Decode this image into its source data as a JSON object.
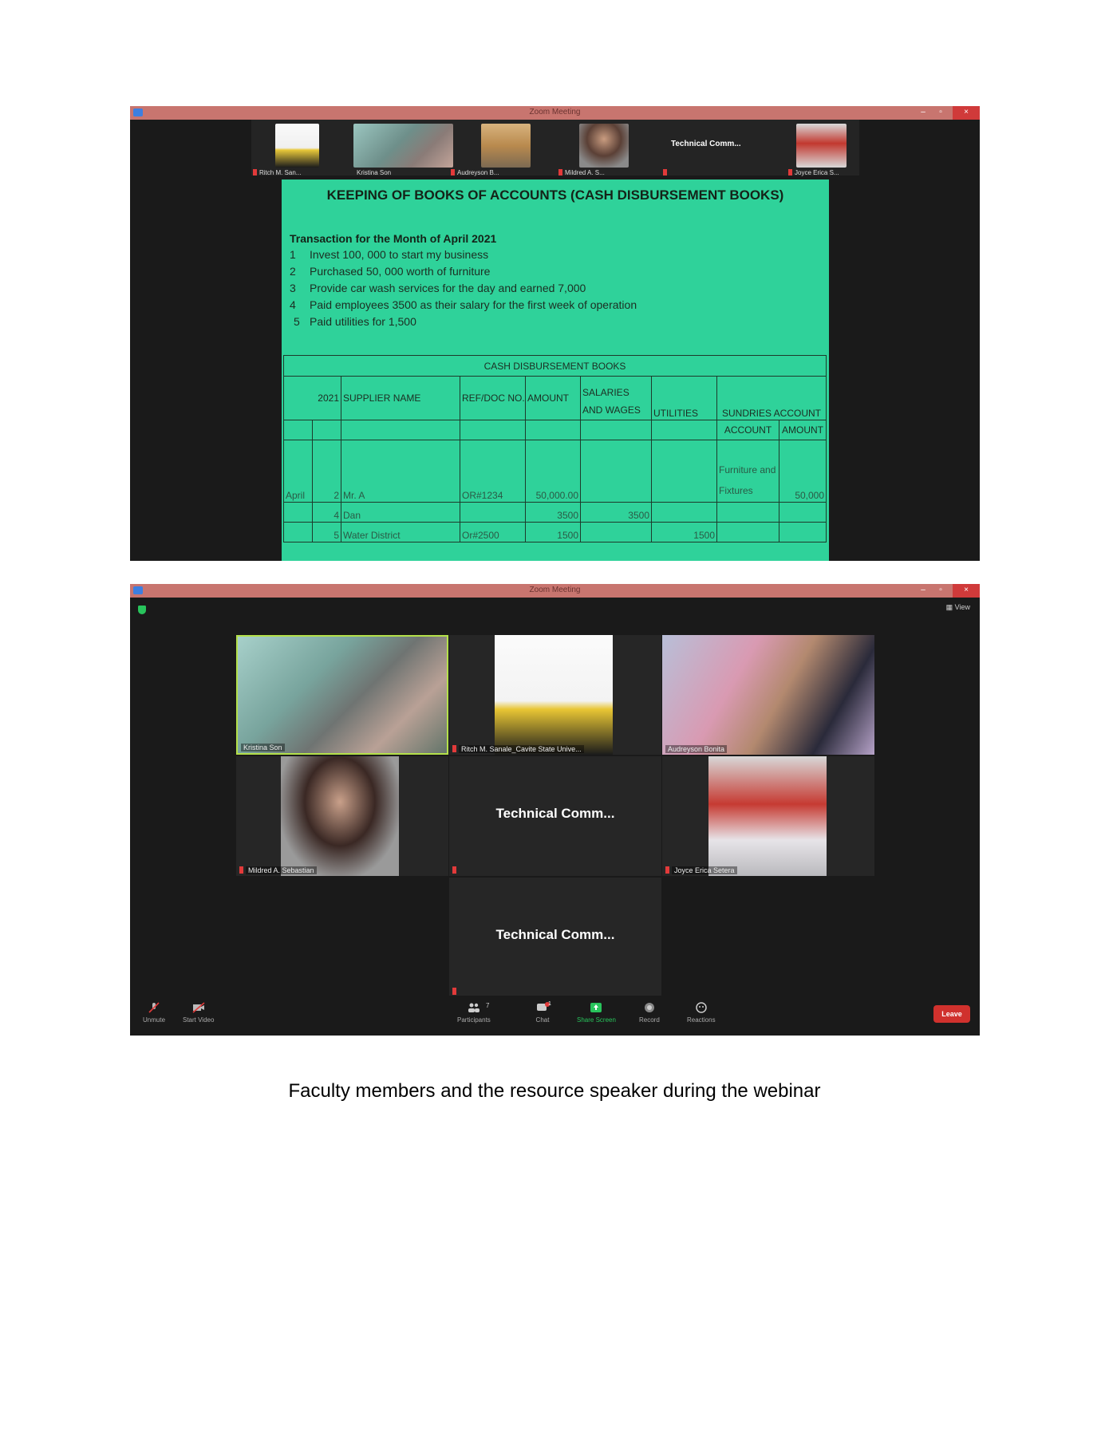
{
  "window1": {
    "title": "Zoom Meeting",
    "controls": [
      "–",
      "▫",
      "×"
    ],
    "thumbnails": [
      {
        "name": "Ritch M. San..."
      },
      {
        "name": "Kristina Son"
      },
      {
        "name": "Audreyson B..."
      },
      {
        "name": "Mildred A. S..."
      },
      {
        "name": "",
        "text": "Technical  Comm..."
      },
      {
        "name": "Joyce Erica S..."
      }
    ],
    "slide": {
      "title": "KEEPING OF BOOKS OF ACCOUNTS (CASH  DISBURSEMENT  BOOKS)",
      "transactions_title": "Transaction  for the Month of April 2021",
      "transactions": [
        {
          "n": "1",
          "text": "Invest 100, 000 to start my business"
        },
        {
          "n": "2",
          "text": "Purchased 50, 000 worth of furniture"
        },
        {
          "n": "3",
          "text": "Provide car wash services for the day and earned 7,000"
        },
        {
          "n": "4",
          "text": "Paid employees 3500 as their salary for the first week of operation"
        },
        {
          "n": "5",
          "text": "Paid utilities for 1,500"
        }
      ],
      "table": {
        "title": "CASH DISBURSEMENT BOOKS",
        "year": "2021",
        "headers": {
          "supplier": "SUPPLIER NAME",
          "ref": "REF/DOC NO.",
          "amount": "AMOUNT",
          "salaries": "SALARIES AND WAGES",
          "utilities": "UTILITIES",
          "sundries": "SUNDRIES ACCOUNT",
          "sub_account": "ACCOUNT",
          "sub_amount": "AMOUNT"
        },
        "rows": [
          {
            "month": "April",
            "day": "2",
            "supplier": "Mr. A",
            "ref": "OR#1234",
            "amount": "50,000.00",
            "salaries": "",
            "utilities": "",
            "account": "Furniture and Fixtures",
            "acct_amount": "50,000"
          },
          {
            "month": "",
            "day": "4",
            "supplier": "Dan",
            "ref": "",
            "amount": "3500",
            "salaries": "3500",
            "utilities": "",
            "account": "",
            "acct_amount": ""
          },
          {
            "month": "",
            "day": "5",
            "supplier": "Water District",
            "ref": "Or#2500",
            "amount": "1500",
            "salaries": "",
            "utilities": "1500",
            "account": "",
            "acct_amount": ""
          }
        ]
      }
    }
  },
  "window2": {
    "title": "Zoom Meeting",
    "view_label": "View",
    "tiles": [
      {
        "name": "Kristina Son"
      },
      {
        "name": "Ritch M. Sanale_Cavite State Unive..."
      },
      {
        "name": "Audreyson Bonita"
      },
      {
        "name": "Mildred A. Sebastian"
      },
      {
        "name": "",
        "text": "Technical  Comm..."
      },
      {
        "name": "Joyce Erica Setera"
      },
      {
        "name": "",
        "text": "Technical  Comm..."
      }
    ],
    "toolbar": {
      "unmute": "Unmute",
      "start_video": "Start Video",
      "participants": "Participants",
      "participants_count": "7",
      "chat": "Chat",
      "chat_badge": "1",
      "share_screen": "Share Screen",
      "record": "Record",
      "reactions": "Reactions",
      "leave": "Leave"
    }
  },
  "caption": "Faculty members and the resource speaker during the webinar",
  "colors": {
    "slide_bg": "#2fd29a",
    "titlebar": "#c8756f",
    "share_green": "#28c45c",
    "leave_red": "#d0312d"
  }
}
